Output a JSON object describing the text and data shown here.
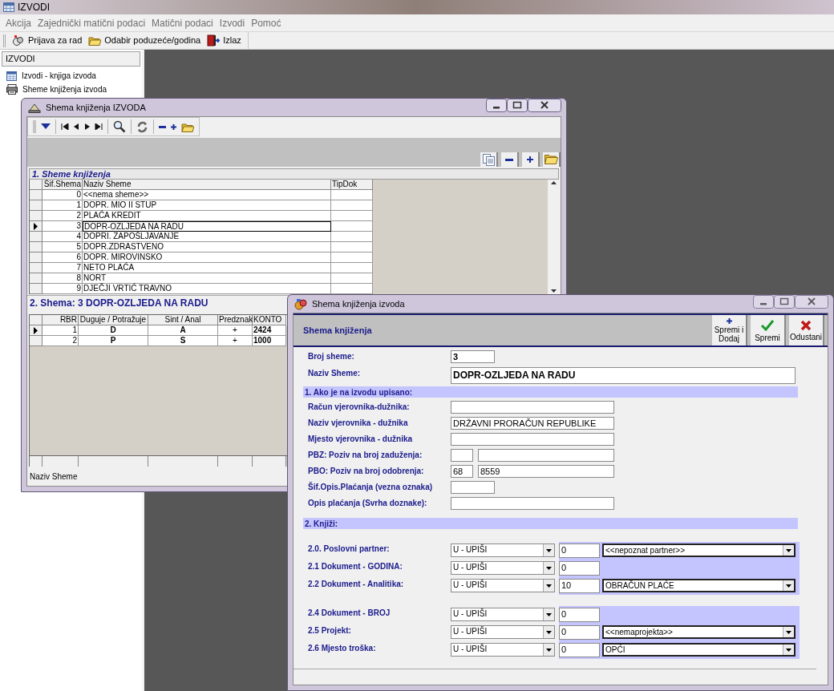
{
  "app": {
    "title": "IZVODI"
  },
  "menu": [
    "Akcija",
    "Zajednički matični podaci",
    "Matični podaci",
    "Izvodi",
    "Pomoć"
  ],
  "toolbar": [
    {
      "label": "Prijava za rad",
      "kind": "login"
    },
    {
      "label": "Odabir poduzeće/godina",
      "kind": "folder"
    },
    {
      "label": "Izlaz",
      "kind": "exit"
    }
  ],
  "sidebar": {
    "title": "IZVODI",
    "items": [
      {
        "label": "Izvodi - knjiga izvoda",
        "kind": "calendar"
      },
      {
        "label": "Sheme knjiženja izvoda",
        "kind": "scheme"
      }
    ]
  },
  "list_window": {
    "title": "Shema knjiženja IZVODA",
    "section_1": "1. Sheme knjiženja",
    "schemes": {
      "columns": [
        "Šif.Shema",
        "Naziv Sheme",
        "TipDok"
      ],
      "rows": [
        {
          "code": "0",
          "name": "<<nema sheme>>",
          "selected": false
        },
        {
          "code": "1",
          "name": "DOPR. MIO II STUP",
          "selected": false
        },
        {
          "code": "2",
          "name": "PLAĆA KREDIT",
          "selected": false
        },
        {
          "code": "3",
          "name": "DOPR-OZLJEDA NA RADU",
          "selected": true
        },
        {
          "code": "4",
          "name": "DOPRI. ZAPOŠLJAVANJE",
          "selected": false
        },
        {
          "code": "5",
          "name": "DOPR.ZDRASTVENO",
          "selected": false
        },
        {
          "code": "6",
          "name": "DOPR. MIROVINSKO",
          "selected": false
        },
        {
          "code": "7",
          "name": "NETO PLAĆA",
          "selected": false
        },
        {
          "code": "8",
          "name": "NORT",
          "selected": false
        },
        {
          "code": "9",
          "name": "DJEČJI VRTIĆ TRAVNO",
          "selected": false
        }
      ]
    },
    "section_2": "2. Shema: 3 DOPR-OZLJEDA NA RADU",
    "entries": {
      "columns": [
        "RBR",
        "Duguje / Potražuje",
        "Sint / Anal",
        "Predznak",
        "KONTO"
      ],
      "rows": [
        {
          "rbr": "1",
          "side": "D",
          "level_type": "A",
          "sign": "+",
          "account": "2424",
          "selected": true
        },
        {
          "rbr": "2",
          "side": "P",
          "level_type": "S",
          "sign": "+",
          "account": "1000",
          "selected": false
        }
      ]
    },
    "status": "Naziv Sheme"
  },
  "form_window": {
    "title": "Shema knjiženja izvoda",
    "header": "Shema knjiženja",
    "buttons": [
      {
        "label": "Spremi i Dodaj",
        "kind": "add"
      },
      {
        "label": "Spremi",
        "kind": "save"
      },
      {
        "label": "Odustani",
        "kind": "cancel"
      }
    ],
    "number": {
      "label": "Broj sheme:",
      "value": "3"
    },
    "name": {
      "label": "Naziv Sheme:",
      "value": "DOPR-OZLJEDA NA RADU"
    },
    "section_1": "1. Ako je na izvodu upisano:",
    "fields": [
      {
        "label": "Račun vjerovnika-dužnika:",
        "kind": "wide"
      },
      {
        "label": "Naziv vjerovnika - dužnika",
        "kind": "wide",
        "value": "DRŽAVNI PRORAČUN REPUBLIKE"
      },
      {
        "label": "Mjesto vjerovnika - dužnika",
        "kind": "wide"
      },
      {
        "label": "PBZ: Poziv na broj zaduženja:",
        "kind": "split"
      },
      {
        "label": "PBO: Poziv na broj odobrenja:",
        "kind": "split",
        "first": "68",
        "second": "8559"
      },
      {
        "label": "Šif.Opis.Plaćanja (vezna oznaka)",
        "kind": "short"
      },
      {
        "label": "Opis plaćanja (Svrha doznake):",
        "kind": "wide"
      }
    ],
    "section_2": "2. Knjiži:",
    "booking_groups": [
      [
        {
          "label": "2.0. Poslovni partner:",
          "mode": "U - UPIŠI",
          "code": "0",
          "lookup": "<<nepoznat partner>>"
        },
        {
          "label": "2.1 Dokument - GODINA:",
          "mode": "U - UPIŠI",
          "code": "0"
        },
        {
          "label": "2.2 Dokument - Analitika:",
          "mode": "U - UPIŠI",
          "code": "10",
          "lookup": "OBRAČUN PLAĆE"
        }
      ],
      [
        {
          "label": "2.4 Dokument - BROJ",
          "mode": "U - UPIŠI",
          "code": "0"
        },
        {
          "label": "2.5 Projekt:",
          "mode": "U - UPIŠI",
          "code": "0",
          "lookup": "<<nemaprojekta>>"
        },
        {
          "label": "2.6 Mjesto troška:",
          "mode": "U - UPIŠI",
          "code": "0",
          "lookup": "OPĆI"
        }
      ]
    ]
  }
}
